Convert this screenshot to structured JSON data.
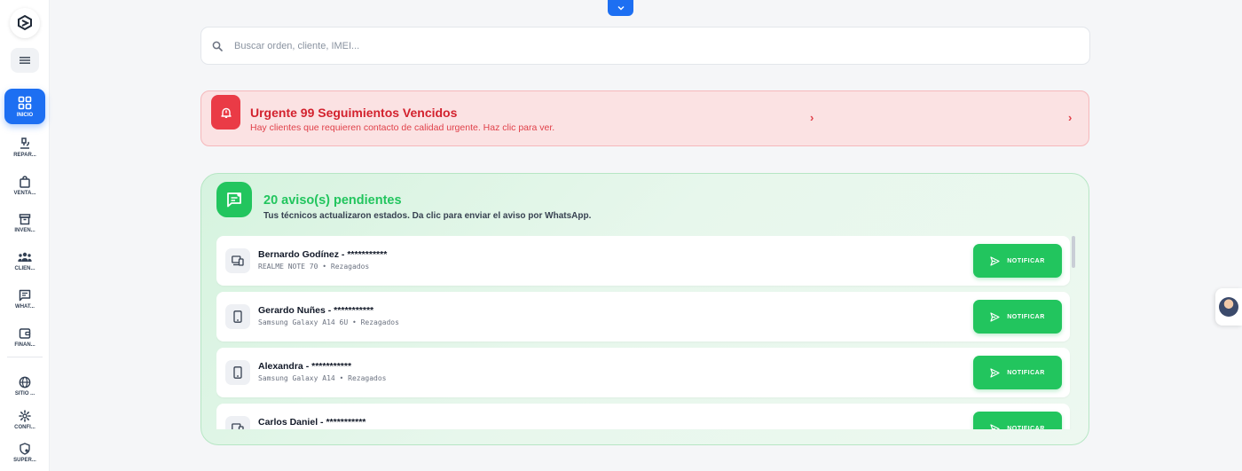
{
  "sidebar": {
    "items": [
      {
        "label": "INICIO",
        "icon": "grid-icon",
        "active": true
      },
      {
        "label": "REPAR...",
        "icon": "microscope-icon",
        "active": false
      },
      {
        "label": "VENTA...",
        "icon": "shopping-bag-icon",
        "active": false
      },
      {
        "label": "INVEN...",
        "icon": "archive-box-icon",
        "active": false
      },
      {
        "label": "CLIEN...",
        "icon": "users-icon",
        "active": false
      },
      {
        "label": "WHAT...",
        "icon": "chat-icon",
        "active": false
      },
      {
        "label": "FINAN...",
        "icon": "wallet-icon",
        "active": false
      },
      {
        "label": "SITIO ...",
        "icon": "globe-icon",
        "active": false
      },
      {
        "label": "CONFI...",
        "icon": "gear-icon",
        "active": false
      },
      {
        "label": "SUPER...",
        "icon": "shield-icon",
        "active": false
      }
    ]
  },
  "search": {
    "placeholder": "Buscar orden, cliente, IMEI..."
  },
  "urgent": {
    "title": "Urgente 99 Seguimientos Vencidos",
    "subtitle": "Hay clientes que requieren contacto de calidad urgente. Haz clic para ver."
  },
  "notices": {
    "title": "20 aviso(s) pendientes",
    "subtitle": "Tus técnicos actualizaron estados. Da clic para enviar el aviso por WhatsApp.",
    "button_label": "NOTIFICAR",
    "rows": [
      {
        "name": "Bernardo Godínez - ***********",
        "meta": "REALME NOTE 70 • Rezagados",
        "icon": "devices-icon"
      },
      {
        "name": "Gerardo Nuñes - ***********",
        "meta": "Samsung Galaxy A14 6U • Rezagados",
        "icon": "smartphone-icon"
      },
      {
        "name": "Alexandra - ***********",
        "meta": "Samsung Galaxy A14 • Rezagados",
        "icon": "smartphone-icon"
      },
      {
        "name": "Carlos Daniel - ***********",
        "meta": "",
        "icon": "devices-icon"
      }
    ]
  },
  "colors": {
    "primary": "#1d6ff2",
    "danger": "#ea3b46",
    "success": "#22c55e"
  }
}
